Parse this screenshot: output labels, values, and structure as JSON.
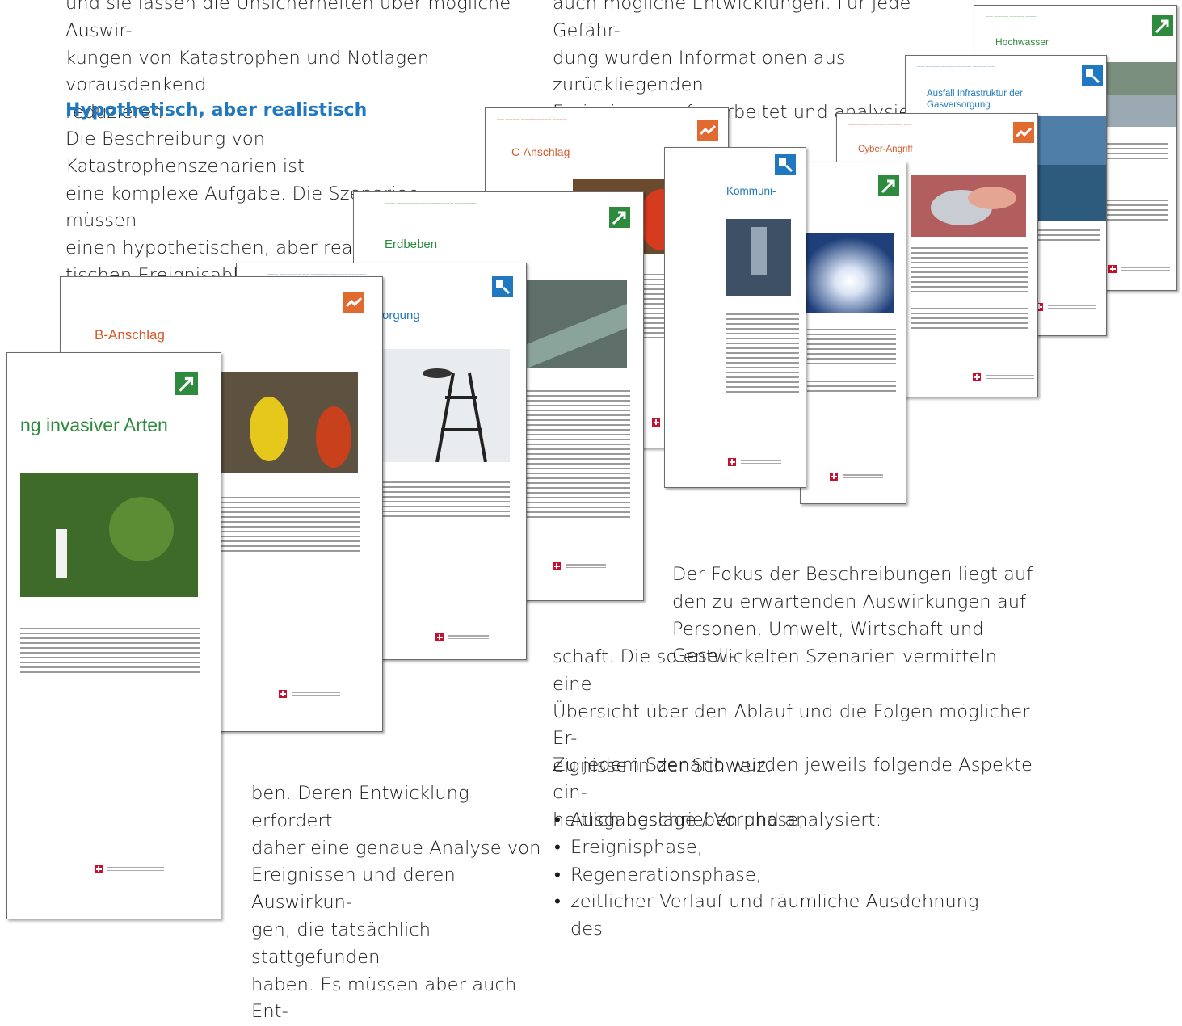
{
  "text": {
    "top_left": "und sie lassen die Unsicherheiten über mögliche Auswir-\nkungen von Katastrophen und Notlagen vorausdenkend\nreduzieren.",
    "top_right": "auch mögliche Entwicklungen. Für jede Gefähr-\ndung wurden Informationen aus zurückliegenden\nEreignissen aufgearbeitet und analysiert.",
    "heading": "Hypothetisch, aber realistisch",
    "intro": "Die Beschreibung von Katastrophenszenarien ist\neine komplexe Aufgabe. Die Szenarien müssen\neinen hypothetischen, aber realis-\ntischen Ereignisablauf beschrei-",
    "middle_bottom": "ben. Deren Entwicklung erfordert\ndaher eine genaue Analyse von\nEreignissen und deren Auswirkun-\ngen, die tatsächlich stattgefunden\nhaben. Es müssen aber auch Ent-",
    "focus_indented": "Der Fokus der Beschreibungen liegt auf\nden zu erwartenden Auswirkungen auf\nPersonen, Umwelt, Wirtschaft und Gesell-",
    "focus_rest": "schaft. Die so entwickelten Szenarien vermitteln eine\nÜbersicht über den Ablauf und die Folgen möglicher Er-\neignisse in der Schweiz.",
    "aspects_intro": "Zu jedem Szenario wurden jeweils folgende Aspekte ein-\nheitlich beschrieben und analysiert:",
    "bullets": [
      "Ausgangslage / Vorphase,",
      "Ereignisphase,",
      "Regenerationsphase,",
      "zeitlicher Verlauf und räumliche Ausdehnung des"
    ]
  },
  "documents": [
    {
      "title": "Hochwasser",
      "color": "#2e8b3e",
      "logo": "green-arrow"
    },
    {
      "title": "Ausfall Infrastruktur der\nGasversorgung",
      "color": "#1f78c0",
      "logo": "blue-square"
    },
    {
      "title": "Cyber-Angriff",
      "color": "#d35a2a",
      "logo": "orange-zigzag"
    },
    {
      "title": "C-Anschlag",
      "color": "#d35a2a",
      "logo": "orange-zigzag"
    },
    {
      "title": "Kommuni-",
      "color": "#1f78c0",
      "logo": "blue-square"
    },
    {
      "title": "Erdbeben",
      "color": "#2e8b3e",
      "logo": "green-arrow"
    },
    {
      "title": "orgung",
      "color": "#1f78c0",
      "logo": "blue-square"
    },
    {
      "title": "B-Anschlag",
      "color": "#d35a2a",
      "logo": "orange-zigzag"
    },
    {
      "title": "ng invasiver Arten",
      "color": "#2e8b3e",
      "logo": "green-arrow"
    }
  ],
  "colors": {
    "heading": "#1f78c0",
    "orange": "#d35a2a",
    "green": "#2e8b3e",
    "blue": "#1f78c0"
  }
}
